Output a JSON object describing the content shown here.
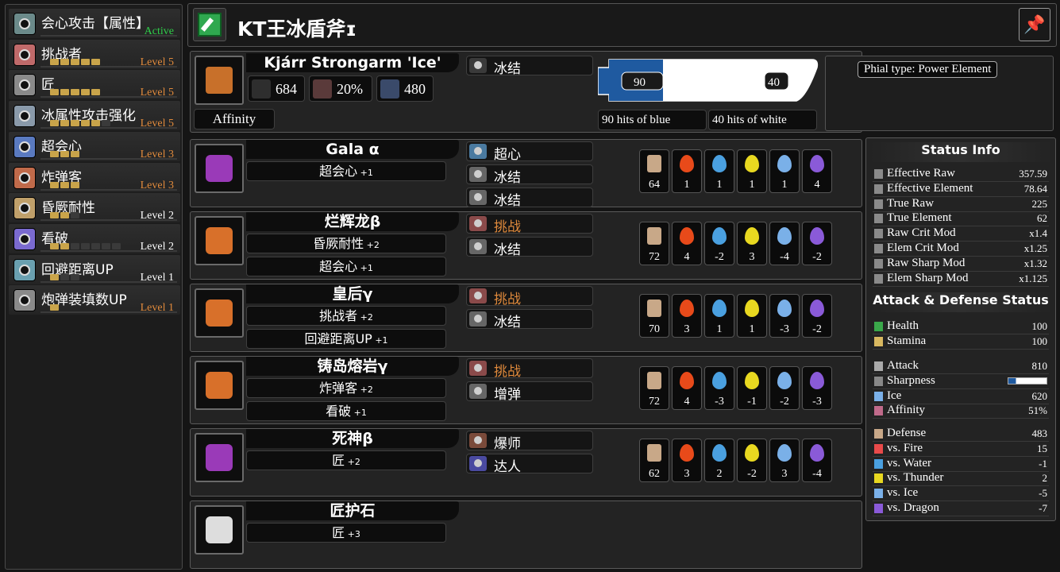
{
  "skills": [
    {
      "name": "会心攻击【属性】",
      "level": "Active",
      "pips": 0,
      "max": 0,
      "levelColor": "#2fcf4a",
      "iconColor": "#6b8a8a"
    },
    {
      "name": "挑战者",
      "level": "Level 5",
      "pips": 5,
      "max": 5,
      "levelColor": "#e08a3c",
      "iconColor": "#c06a6a"
    },
    {
      "name": "匠",
      "level": "Level 5",
      "pips": 5,
      "max": 5,
      "levelColor": "#e08a3c",
      "iconColor": "#8a8a8a"
    },
    {
      "name": "冰属性攻击强化",
      "level": "Level 5",
      "pips": 5,
      "max": 6,
      "levelColor": "#e08a3c",
      "iconColor": "#8a9aaa"
    },
    {
      "name": "超会心",
      "level": "Level 3",
      "pips": 3,
      "max": 3,
      "levelColor": "#e08a3c",
      "iconColor": "#5a7ac0"
    },
    {
      "name": "炸弹客",
      "level": "Level 3",
      "pips": 3,
      "max": 3,
      "levelColor": "#e08a3c",
      "iconColor": "#c06a4a"
    },
    {
      "name": "昏厥耐性",
      "level": "Level 2",
      "pips": 2,
      "max": 3,
      "levelColor": "#ffffff",
      "iconColor": "#c0a06a"
    },
    {
      "name": "看破",
      "level": "Level 2",
      "pips": 2,
      "max": 7,
      "levelColor": "#ffffff",
      "iconColor": "#7a6ad0"
    },
    {
      "name": "回避距离UP",
      "level": "Level 1",
      "pips": 1,
      "max": 3,
      "levelColor": "#ffffff",
      "iconColor": "#6aa0b0"
    },
    {
      "name": "炮弹装填数UP",
      "level": "Level 1",
      "pips": 1,
      "max": 1,
      "levelColor": "#e08a3c",
      "iconColor": "#8a8a8a"
    }
  ],
  "header": {
    "title": "KT王冰盾斧ɪ"
  },
  "weapon": {
    "name": "Kjárr Strongarm 'Ice'",
    "attack": "684",
    "affinity": "20%",
    "element": "480",
    "affinity_label": "Affinity",
    "deco": "冰结",
    "blue_hits": "90",
    "white_hits": "40",
    "blue_label": "90 hits of blue",
    "white_label": "40 hits of white",
    "phial": "Phial type: Power Element"
  },
  "armor": [
    {
      "name": "Gala α",
      "skills": [
        [
          "超会心",
          "+1"
        ]
      ],
      "decos": [
        [
          "超心",
          "#4a7aa0"
        ],
        [
          "冰结",
          "#666"
        ],
        [
          "冰结",
          "#666"
        ]
      ],
      "res": [
        "64",
        "1",
        "1",
        "1",
        "1",
        "4"
      ],
      "iconColor": "#9a3ab8",
      "decoColor": "#ffffff"
    },
    {
      "name": "烂辉龙β",
      "skills": [
        [
          "昏厥耐性",
          "+2"
        ],
        [
          "超会心",
          "+1"
        ]
      ],
      "decos": [
        [
          "挑战",
          "#8a4a4a"
        ],
        [
          "冰结",
          "#666"
        ]
      ],
      "res": [
        "72",
        "4",
        "-2",
        "3",
        "-4",
        "-2"
      ],
      "iconColor": "#d8702a",
      "decoColor": "#e08a3c"
    },
    {
      "name": "皇后γ",
      "skills": [
        [
          "挑战者",
          "+2"
        ],
        [
          "回避距离UP",
          "+1"
        ]
      ],
      "decos": [
        [
          "挑战",
          "#8a4a4a"
        ],
        [
          "冰结",
          "#666"
        ]
      ],
      "res": [
        "70",
        "3",
        "1",
        "1",
        "-3",
        "-2"
      ],
      "iconColor": "#d8702a",
      "decoColor": "#e08a3c"
    },
    {
      "name": "铸岛熔岩γ",
      "skills": [
        [
          "炸弹客",
          "+2"
        ],
        [
          "看破",
          "+1"
        ]
      ],
      "decos": [
        [
          "挑战",
          "#8a4a4a"
        ],
        [
          "增弹",
          "#666"
        ]
      ],
      "res": [
        "72",
        "4",
        "-3",
        "-1",
        "-2",
        "-3"
      ],
      "iconColor": "#d8702a",
      "decoColor": "#e08a3c"
    },
    {
      "name": "死神β",
      "skills": [
        [
          "匠",
          "+2"
        ]
      ],
      "decos": [
        [
          "爆师",
          "#7a4a3a"
        ],
        [
          "达人",
          "#4a4aa0"
        ]
      ],
      "res": [
        "62",
        "3",
        "2",
        "-2",
        "3",
        "-4"
      ],
      "iconColor": "#9a3ab8",
      "decoColor": "#ffffff"
    },
    {
      "name": "匠护石",
      "skills": [
        [
          "匠",
          "+3"
        ]
      ],
      "decos": [],
      "res": [],
      "iconColor": "#dddddd",
      "decoColor": "#ffffff"
    }
  ],
  "status": {
    "title": "Status Info",
    "rows": [
      [
        "Effective Raw",
        "357.59"
      ],
      [
        "Effective Element",
        "78.64"
      ],
      [
        "True Raw",
        "225"
      ],
      [
        "True Element",
        "62"
      ],
      [
        "Raw Crit Mod",
        "x1.4"
      ],
      [
        "Elem Crit Mod",
        "x1.25"
      ],
      [
        "Raw Sharp Mod",
        "x1.32"
      ],
      [
        "Elem Sharp Mod",
        "x1.125"
      ]
    ],
    "ad_title": "Attack & Defense Status",
    "health": [
      "Health",
      "100"
    ],
    "stamina": [
      "Stamina",
      "100"
    ],
    "attack_rows": [
      [
        "Attack",
        "810"
      ],
      [
        "Sharpness",
        ""
      ],
      [
        "Ice",
        "620"
      ],
      [
        "Affinity",
        "51%"
      ]
    ],
    "defense_rows": [
      [
        "Defense",
        "483"
      ],
      [
        "vs. Fire",
        "15"
      ],
      [
        "vs. Water",
        "-1"
      ],
      [
        "vs. Thunder",
        "2"
      ],
      [
        "vs. Ice",
        "-5"
      ],
      [
        "vs. Dragon",
        "-7"
      ]
    ]
  }
}
